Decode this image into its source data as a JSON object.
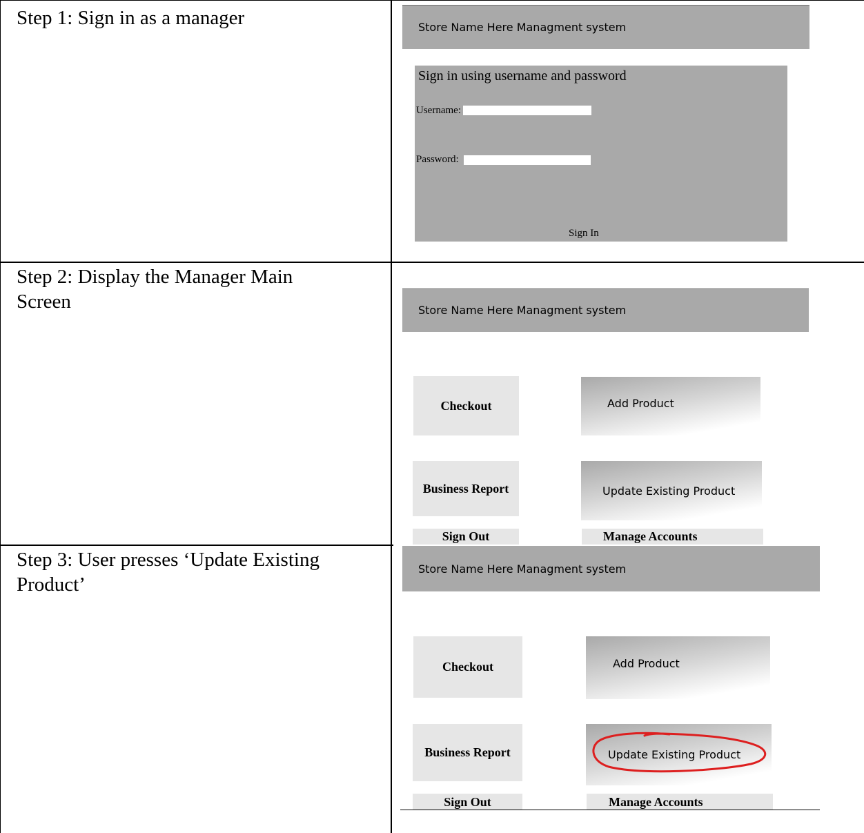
{
  "steps": [
    {
      "label": "Step 1: Sign in as a manager"
    },
    {
      "label": "Step 2: Display the Manager Main Screen"
    },
    {
      "label": "Step 3: User presses ‘Update Existing Product’"
    }
  ],
  "app": {
    "title": "Store Name Here Managment system"
  },
  "signin": {
    "heading": "Sign in using username and password",
    "username_label": "Username:",
    "username_value": "",
    "password_label": "Password:",
    "password_value": "",
    "button": "Sign In"
  },
  "main_menu": {
    "checkout": "Checkout",
    "add_product": "Add Product",
    "business_report": "Business Report",
    "update_product": "Update Existing Product",
    "sign_out": "Sign Out",
    "manage_accounts": "Manage Accounts"
  },
  "highlight": {
    "color": "#dd1f1f",
    "target": "Update Existing Product"
  }
}
